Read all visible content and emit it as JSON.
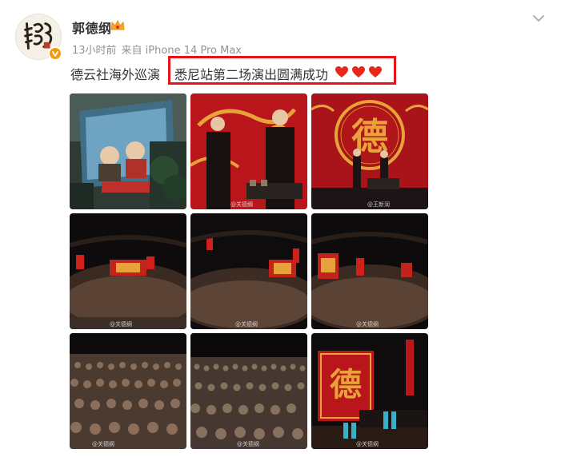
{
  "author": {
    "name": "郭德纲",
    "verified": true
  },
  "meta": {
    "time": "13小时前",
    "source": "来自 iPhone 14 Pro Max"
  },
  "post": {
    "text_prefix": "德云社海外巡演",
    "text_highlight": "悉尼站第二场演出圆满成功",
    "hearts_count": 3
  },
  "photos": [
    {
      "id": 1,
      "desc": "screen-outdoor",
      "watermark": ""
    },
    {
      "id": 2,
      "desc": "two-performers-red-stage",
      "watermark": "@关德纲"
    },
    {
      "id": 3,
      "desc": "stage-large-logo",
      "watermark": "@王新润"
    },
    {
      "id": 4,
      "desc": "arena-wide",
      "watermark": "@关德纲"
    },
    {
      "id": 5,
      "desc": "arena-wide-2",
      "watermark": "@关德纲"
    },
    {
      "id": 6,
      "desc": "arena-wide-3",
      "watermark": "@关德纲"
    },
    {
      "id": 7,
      "desc": "audience-closeup",
      "watermark": "@关德纲"
    },
    {
      "id": 8,
      "desc": "audience-wide",
      "watermark": "@关德纲"
    },
    {
      "id": 9,
      "desc": "stage-bow",
      "watermark": "@关德纲"
    }
  ],
  "colors": {
    "highlight_border": "#e8131a",
    "heart": "#e8261c",
    "text": "#333333",
    "meta": "#939393",
    "badge": "#f59a0b"
  }
}
